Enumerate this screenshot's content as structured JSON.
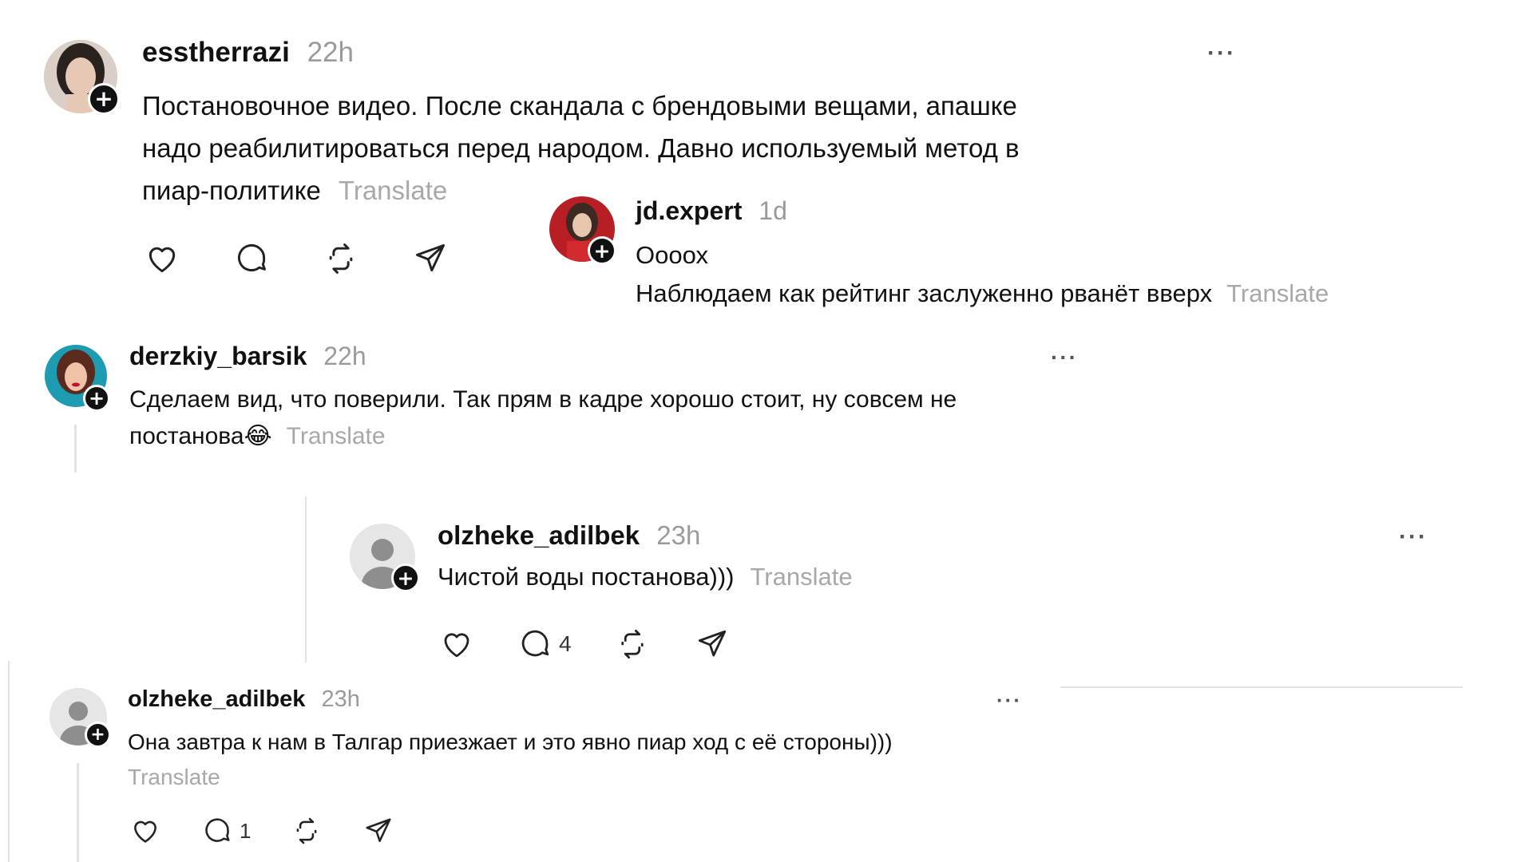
{
  "colors": {
    "text": "#111111",
    "muted": "#9a9a9a",
    "translate": "#a8a8a8",
    "divider": "#e3e3e3"
  },
  "posts": [
    {
      "username": "esstherrazi",
      "time": "22h",
      "lines": [
        "Постановочное видео. После скандала с брендовыми вещами, апашке",
        "надо реабилитироваться перед народом. Давно используемый метод в",
        "пиар-политике"
      ],
      "translate": "Translate",
      "actions": [
        "heart-icon",
        "comment-icon",
        "repost-icon",
        "share-icon"
      ]
    },
    {
      "username": "jd.expert",
      "time": "1d",
      "lines": [
        "Оооох",
        "Наблюдаем как рейтинг заслуженно рванёт вверх"
      ],
      "translate": "Translate"
    },
    {
      "username": "derzkiy_barsik",
      "time": "22h",
      "lines": [
        "Сделаем вид, что поверили. Так прям в кадре хорошо стоит, ну совсем не",
        "постанова"
      ],
      "emoji": "😂",
      "translate": "Translate"
    },
    {
      "username": "olzheke_adilbek",
      "time": "23h",
      "lines": [
        "Чистой воды постанова)))"
      ],
      "translate": "Translate",
      "comment_count": "4"
    },
    {
      "username": "olzheke_adilbek",
      "time": "23h",
      "lines": [
        "Она завтра к нам в Талгар приезжает и это явно пиар ход с её стороны)))"
      ],
      "translate": "Translate",
      "comment_count": "1"
    }
  ]
}
